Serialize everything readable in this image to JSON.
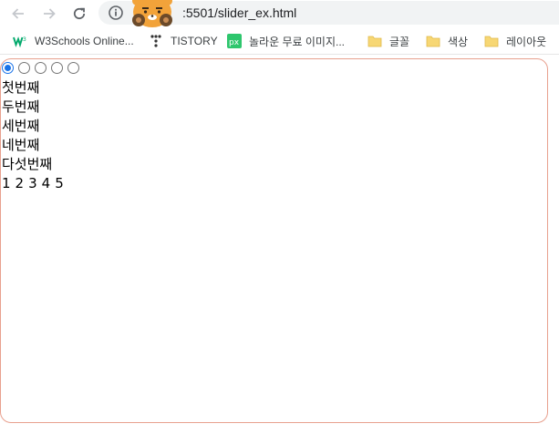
{
  "browser": {
    "url": ":5501/slider_ex.html",
    "icons": [
      "back-arrow-icon",
      "forward-arrow-icon",
      "reload-icon",
      "info-icon",
      "kakao-ryan-sticker"
    ]
  },
  "bookmarks": [
    {
      "label": "W3Schools Online...",
      "icon": "w3schools-icon"
    },
    {
      "label": "TISTORY",
      "icon": "tistory-icon"
    },
    {
      "label": "놀라운 무료 이미지...",
      "icon": "pixabay-icon"
    },
    {
      "label": "글꼴",
      "icon": "folder-icon"
    },
    {
      "label": "색상",
      "icon": "folder-icon"
    },
    {
      "label": "레이아웃",
      "icon": "folder-icon"
    }
  ],
  "slider": {
    "selected_index": 0,
    "radio_count": 5,
    "slides": [
      "첫번째",
      "두번째",
      "세번째",
      "네번째",
      "다섯번째"
    ],
    "pager": [
      "1",
      "2",
      "3",
      "4",
      "5"
    ]
  },
  "colors": {
    "frame_border": "#e8a08e",
    "radio_accent": "#1a73e8",
    "folder": "#f7d774",
    "w3schools": "#04aa6d",
    "pixabay": "#2ec66d"
  }
}
